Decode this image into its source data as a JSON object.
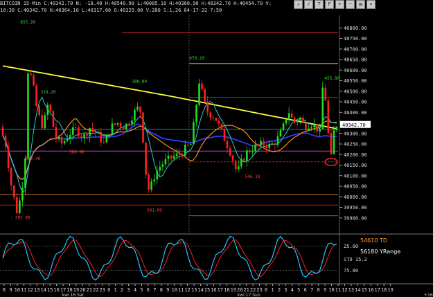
{
  "header": {
    "line1": "BITCOIN  15-Min  C:40342.70  N:  -18.40  H:40540.90  L:40085.10  H:40360.90  H:40342.70  H:40454.70  V:",
    "line2": "10:30  C:40342.70  H:40364.10  L:40317.60  O:40325.00  V:280  S:1.26  04-17-22  7:50"
  },
  "toolbar": {
    "buttons": [
      "arrow",
      "line",
      "text",
      "fib",
      "zoom",
      "draw",
      "chart",
      "close"
    ]
  },
  "colors": {
    "bg": "#000000",
    "sma_yellow": "#ffff40",
    "ma_blue": "#2a3cff",
    "ema_orange": "#ff8c1a",
    "ema_teal": "#27d0c8",
    "bull": "#22dd22",
    "bear": "#ff2020",
    "level_green": "#7fbf3f",
    "level_red": "#cc2222",
    "level_magenta": "#c040c0",
    "level_orange": "#e08a1a",
    "level_cyan": "#18a8a8",
    "current_price_bg": "#ffffff",
    "stoch_main": "#22c8ff",
    "stoch_signal": "#ff2020"
  },
  "chart_data": [
    {
      "type": "candlestick",
      "title": "BITCOIN 15-Min",
      "ylim": [
        39850,
        40860
      ],
      "yticks": [
        "40800.00",
        "40750.00",
        "40700.00",
        "40650.00",
        "40600.00",
        "40550.00",
        "40500.00",
        "40450.00",
        "40400.00",
        "40350.00",
        "40300.00",
        "40250.00",
        "40200.00",
        "40150.00",
        "40100.00",
        "40050.00",
        "40000.00",
        "39950.00",
        "39900.00"
      ],
      "current_price": "40342.70",
      "levels": [
        {
          "label": "R2  40779.23",
          "value": 40779.23,
          "color": "#cc2222",
          "start": 0.36,
          "style": "solid"
        },
        {
          "label": "YH  40631.20",
          "value": 40631.2,
          "color": "#d8d840",
          "start": 0.56,
          "style": "solid"
        },
        {
          "label": "R1  40471.32",
          "value": 40471.32,
          "color": "#cc2222",
          "start": 0.56,
          "style": "solid"
        },
        {
          "label": "H3  40320.00",
          "value": 40320.0,
          "color": "#18a8a8",
          "start": 0.0,
          "style": "solid"
        },
        {
          "label": "PP  40216.43",
          "value": 40216.43,
          "color": "#c040c0",
          "start": 0.0,
          "style": "solid"
        },
        {
          "label": "ROVR  40165.50",
          "value": 40165.5,
          "color": "#dd3030",
          "start": 0.56,
          "style": "dashed"
        },
        {
          "label": "L3  40011.00",
          "value": 40011.0,
          "color": "#e08a1a",
          "start": 0.0,
          "style": "solid"
        },
        {
          "label": "YL  39961.00",
          "value": 39961.0,
          "color": "#cc2222",
          "start": 0.0,
          "style": "solid"
        },
        {
          "label": "S1  39910.07",
          "value": 39910.07,
          "color": "#3aaa3a",
          "start": 0.56,
          "style": "solid"
        }
      ],
      "annotations": [
        {
          "text": "855.20",
          "color": "#3adc3a",
          "x": 0.06,
          "y": 40820
        },
        {
          "text": "310.20",
          "color": "#3adc3a",
          "x": 0.12,
          "y": 40490
        },
        {
          "text": "288.80",
          "color": "#3adc3a",
          "x": 0.39,
          "y": 40540
        },
        {
          "text": "670.20",
          "color": "#3adc3a",
          "x": 0.56,
          "y": 40650
        },
        {
          "text": "455.80",
          "color": "#3adc3a",
          "x": 0.96,
          "y": 40555
        },
        {
          "text": "- 388.00",
          "color": "#ff4040",
          "x": 0.19,
          "y": 40205
        },
        {
          "text": "- 512.40",
          "color": "#ff4040",
          "x": 0.06,
          "y": 40175
        },
        {
          "text": "- 392.00",
          "color": "#ff4040",
          "x": 0.03,
          "y": 39895
        },
        {
          "text": "- 561.00",
          "color": "#ff4040",
          "x": 0.42,
          "y": 39930
        },
        {
          "text": "- 546.10",
          "color": "#ff4040",
          "x": 0.71,
          "y": 40090
        }
      ],
      "y_last": 40342.7
    },
    {
      "type": "line",
      "title": "STO",
      "ylim": [
        0,
        100
      ],
      "yticks": [
        "25.00",
        "75.00"
      ],
      "label_text": "STO  15.2",
      "overlay_text": [
        "54610 TD",
        "56180 YRange"
      ]
    }
  ],
  "xaxis": {
    "ticks": [
      "8",
      "9",
      "10",
      "11",
      "12",
      "13",
      "14",
      "15",
      "16",
      "17",
      "18",
      "19",
      "20",
      "21",
      "22",
      "23",
      "0",
      "1",
      "2",
      "3",
      "4",
      "5",
      "6",
      "7",
      "8",
      "9",
      "10",
      "11",
      "12",
      "13",
      "14",
      "15",
      "16",
      "17",
      "18",
      "19",
      "20",
      "21",
      "22",
      "23",
      "0",
      "1",
      "2",
      "3",
      "4",
      "5",
      "6",
      "7",
      "8",
      "9",
      "10",
      "11",
      "12",
      "13",
      "14",
      "15",
      "16",
      "17",
      "18",
      "19"
    ],
    "day_labels": [
      {
        "text": "kwi 16 Sat",
        "pos": 0.215
      },
      {
        "text": "kwi 17 Sun",
        "pos": 0.733
      }
    ],
    "corner_label": "+16"
  }
}
